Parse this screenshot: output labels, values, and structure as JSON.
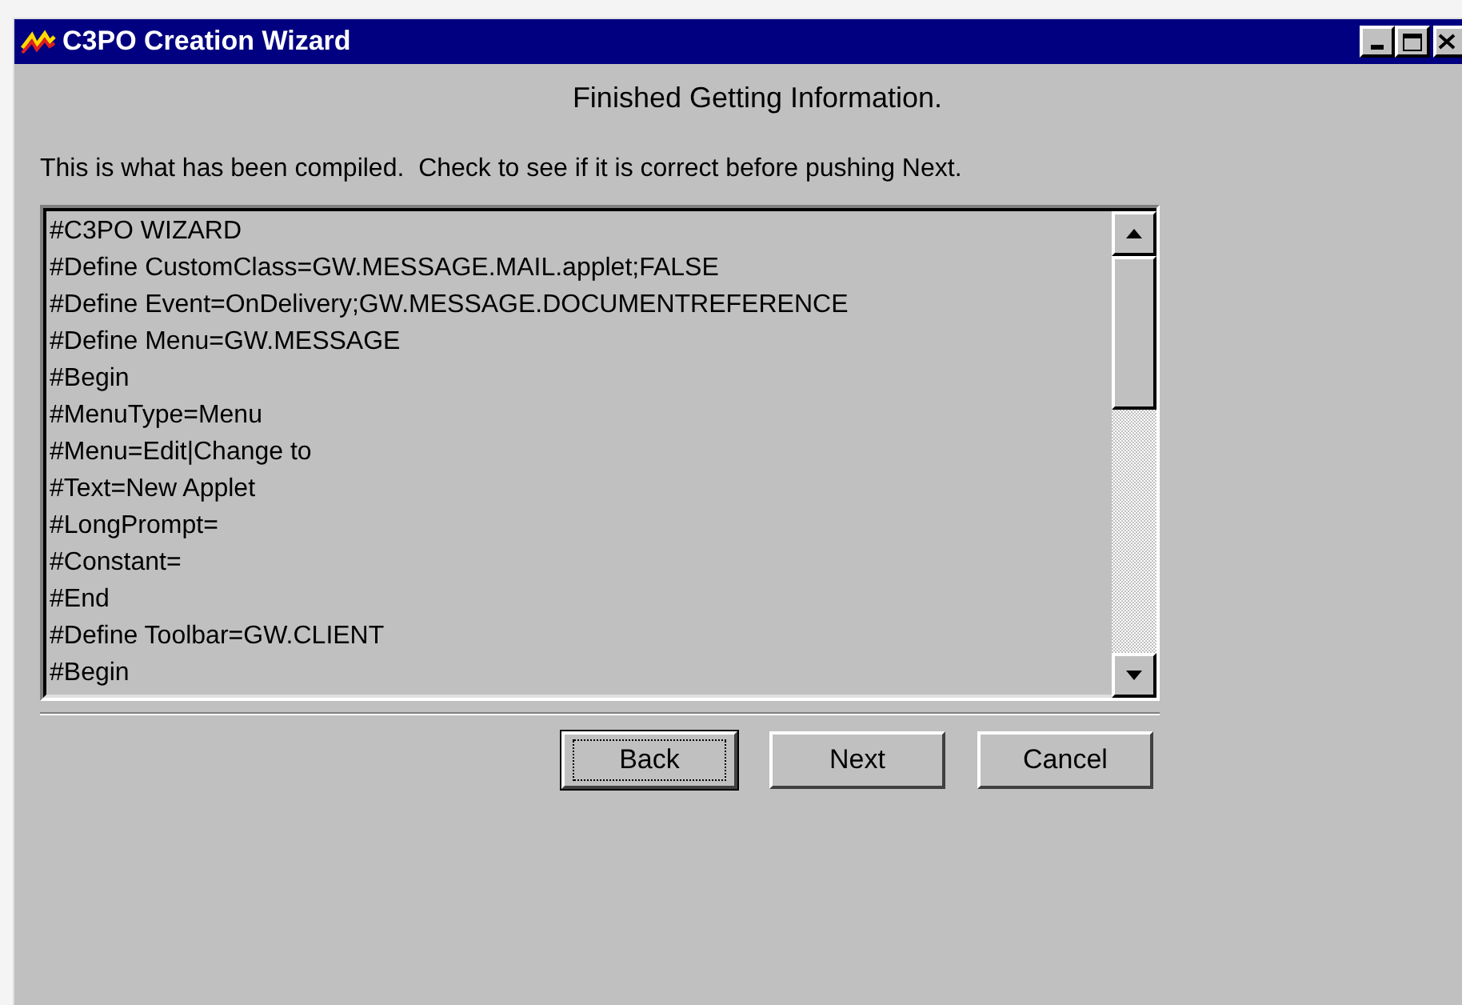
{
  "window": {
    "title": "C3PO Creation Wizard"
  },
  "heading": "Finished Getting Information.",
  "instruction": "This is what has been compiled.  Check to see if it is correct before pushing Next.",
  "listing": {
    "lines": [
      "#C3PO WIZARD",
      "#Define CustomClass=GW.MESSAGE.MAIL.applet;FALSE",
      "#Define Event=OnDelivery;GW.MESSAGE.DOCUMENTREFERENCE",
      "#Define Menu=GW.MESSAGE",
      "#Begin",
      "#MenuType=Menu",
      "#Menu=Edit|Change to",
      "#Text=New Applet",
      "#LongPrompt=",
      "#Constant=",
      "#End",
      "#Define Toolbar=GW.CLIENT",
      "#Begin"
    ]
  },
  "buttons": [
    {
      "label": "Back",
      "focused": true
    },
    {
      "label": "Next",
      "focused": false
    },
    {
      "label": "Cancel",
      "focused": false
    }
  ]
}
